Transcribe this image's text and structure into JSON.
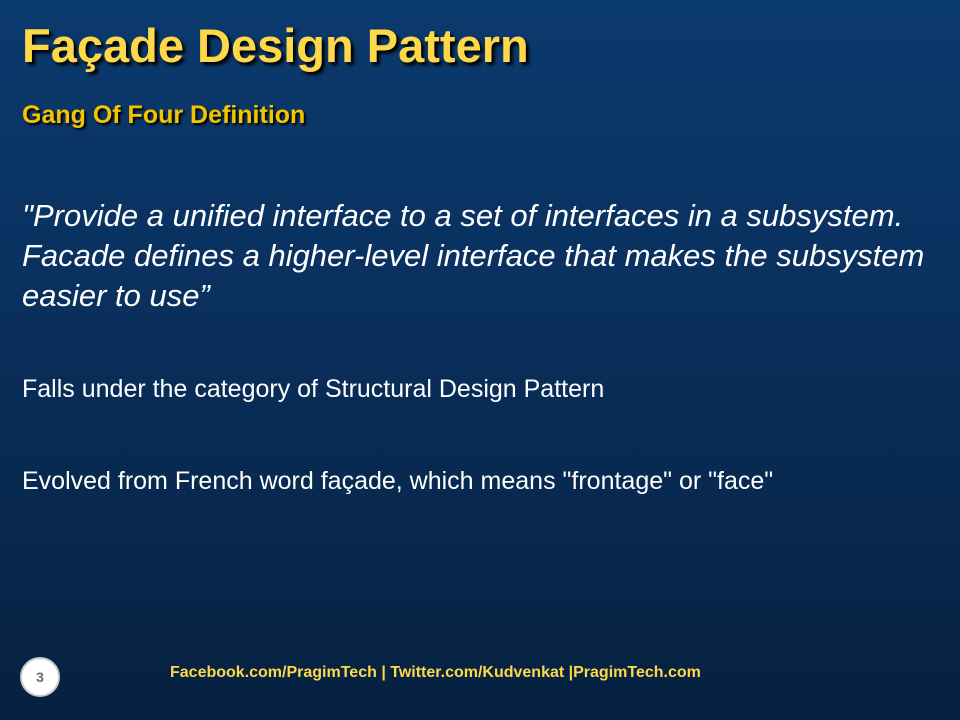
{
  "slide": {
    "title": "Façade Design Pattern",
    "subtitle": "Gang Of Four Definition",
    "quote": "\"Provide a unified interface to a set of interfaces in a subsystem. Facade defines a higher-level interface that makes the subsystem easier to use”",
    "points": [
      "Falls under the category of Structural Design Pattern",
      "Evolved from French word façade, which means \"frontage\" or \"face\""
    ],
    "slide_number": "3",
    "footer": "Facebook.com/PragimTech  | Twitter.com/Kudvenkat  |PragimTech.com"
  },
  "colors": {
    "background_top": "#0b3a6e",
    "background_bottom": "#06213f",
    "title": "#ffd84a",
    "subtitle": "#f5c400",
    "body_text": "#ffffff"
  }
}
